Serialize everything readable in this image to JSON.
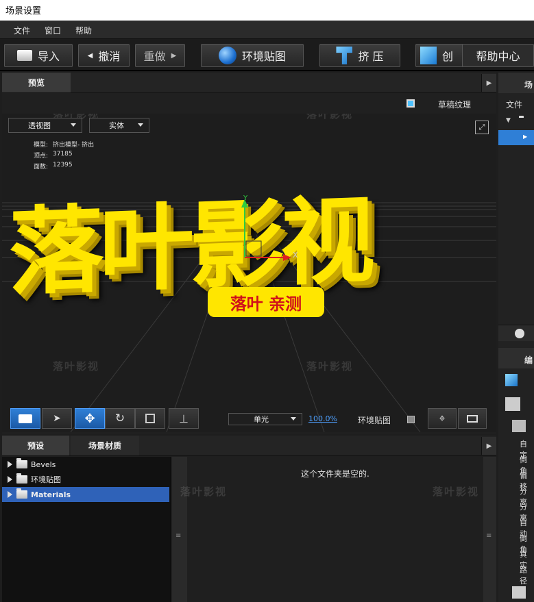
{
  "window": {
    "title": "场景设置"
  },
  "menu": [
    "文件",
    "窗口",
    "帮助"
  ],
  "toolbar": {
    "import": "导入",
    "undo": "撤消",
    "redo": "重做",
    "env_map": "环境贴图",
    "extrude": "挤 压",
    "create": "创",
    "help_center": "帮助中心"
  },
  "preview": {
    "tab": "预览",
    "draft_texture": "草稿纹理",
    "view_mode": "透视图",
    "shade_mode": "实体",
    "stats": {
      "model_label": "模型:",
      "model_value": "挤出模型- 挤出",
      "vertices_label": "顶点:",
      "vertices_value": "37185",
      "faces_label": "面数:",
      "faces_value": "12395"
    },
    "scene_text": "落叶影视",
    "badge_text": "落叶 亲测",
    "axis_x": "X",
    "light_mode": "单光",
    "zoom": "100.0%",
    "env_map_toggle": "环境贴图"
  },
  "right_panel": {
    "tab": "场",
    "file_col": "文件",
    "edit_tab": "编",
    "edit_items": [
      "自定",
      "倒角",
      "偏移",
      "分离",
      "分离",
      "自动",
      "倒角",
      "真实",
      "路径"
    ]
  },
  "bottom": {
    "tabs": [
      "预设",
      "场景材质"
    ],
    "tree": [
      "Bevels",
      "环境贴图",
      "Materials"
    ],
    "empty_msg": "这个文件夹是空的."
  },
  "watermark": "落叶影视",
  "colors": {
    "accent": "#2f7fd6",
    "text_yellow": "#ffe600",
    "badge_red": "#d0101a"
  }
}
